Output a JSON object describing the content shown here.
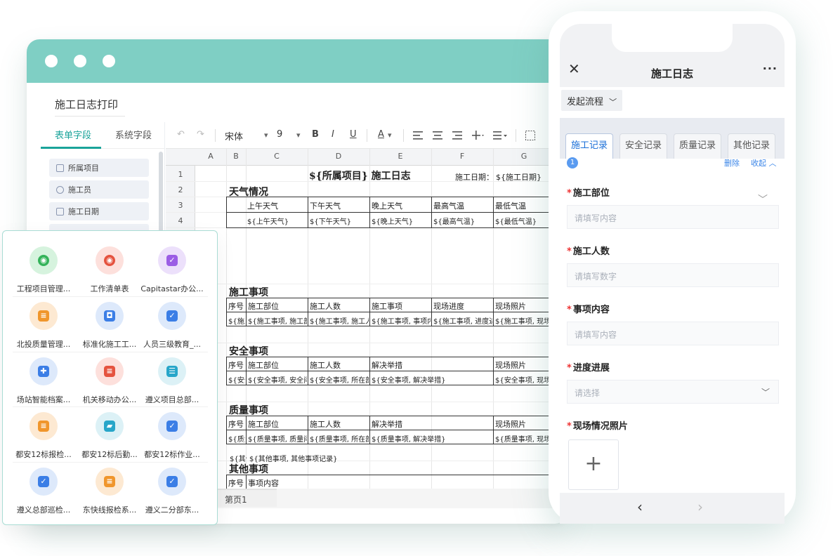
{
  "desktop": {
    "doc_title": "施工日志打印",
    "side_tabs": [
      "表单字段",
      "系统字段"
    ],
    "fields": [
      "所属项目",
      "施工员",
      "施工日期"
    ],
    "toolbar": {
      "undo": "↶",
      "redo": "↷",
      "font": "宋体",
      "font_caret": "▾",
      "size": "9",
      "size_caret": "▾",
      "bold": "B",
      "italic": "I",
      "underline": "U",
      "font_color": "A",
      "color_caret": "▾"
    },
    "columns": [
      "A",
      "B",
      "C",
      "D",
      "E",
      "F",
      "G"
    ],
    "rows": [
      "1",
      "2",
      "3",
      "4"
    ],
    "sheet_tab": "第页1"
  },
  "sheet": {
    "title": "${所属项目} 施工日志",
    "date_label": "施工日期：",
    "date_value": "${施工日期}",
    "weather": {
      "heading": "天气情况",
      "headers": [
        "上午天气",
        "下午天气",
        "晚上天气",
        "最高气温",
        "最低气温"
      ],
      "values": [
        "${上午天气}",
        "${下午天气}",
        "${晚上天气}",
        "${最高气温}",
        "${最低气温}"
      ]
    },
    "construction": {
      "heading": "施工事项",
      "headers": [
        "序号",
        "施工部位",
        "施工人数",
        "施工事项",
        "现场进度",
        "现场照片"
      ],
      "values": [
        "${施工事项",
        "${施工事项, 施工部位}",
        "${施工事项, 施工人数}",
        "${施工事项, 事项内容}",
        "${施工事项, 进度进展}",
        "${施工事项, 现场情况照片}"
      ]
    },
    "safety": {
      "heading": "安全事项",
      "headers": [
        "序号",
        "施工部位",
        "施工人数",
        "解决举措",
        "现场照片"
      ],
      "values": [
        "${安全",
        "${安全事项, 安全问题点}",
        "${安全事项, 所在部位}",
        "${安全事项, 解决举措}",
        "${安全事项, 现场照片}"
      ]
    },
    "quality": {
      "heading": "质量事项",
      "headers": [
        "序号",
        "施工部位",
        "施工人数",
        "解决举措",
        "现场照片"
      ],
      "values": [
        "${质量",
        "${质量事项, 质量问题点}",
        "${质量事项, 所在部位}",
        "${质量事项, 解决举措}",
        "${质量事项, 现场照片}"
      ]
    },
    "other": {
      "heading": "其他事项",
      "headers": [
        "序号",
        "事项内容"
      ],
      "values": [
        "${其他事项",
        "${其他事项, 其他事项记录}"
      ]
    }
  },
  "apps": [
    {
      "label": "工程项目管理...",
      "color": "#d6f3de",
      "glyph_color": "#34b35a",
      "icon": "globe-icon"
    },
    {
      "label": "工作清单表",
      "color": "#fde0dc",
      "glyph_color": "#e5533f",
      "icon": "globe-icon"
    },
    {
      "label": "Capitastar办公...",
      "color": "#ece0fb",
      "glyph_color": "#9b5de5",
      "icon": "shield-check-icon"
    },
    {
      "label": "北投质量管理...",
      "color": "#fde9d2",
      "glyph_color": "#f0962c",
      "icon": "document-icon"
    },
    {
      "label": "标准化施工工...",
      "color": "#dde9fb",
      "glyph_color": "#3b7ee6",
      "icon": "robot-icon"
    },
    {
      "label": "人员三级教育_...",
      "color": "#dde9fb",
      "glyph_color": "#3b7ee6",
      "icon": "shield-check-icon"
    },
    {
      "label": "场站智能档案...",
      "color": "#dde9fb",
      "glyph_color": "#3b7ee6",
      "icon": "puzzle-icon"
    },
    {
      "label": "机关移动办公...",
      "color": "#fde0dc",
      "glyph_color": "#e5533f",
      "icon": "document-icon"
    },
    {
      "label": "遵义项目总部...",
      "color": "#dcf1f6",
      "glyph_color": "#27a6c9",
      "icon": "database-icon"
    },
    {
      "label": "都安12标报检...",
      "color": "#fde9d2",
      "glyph_color": "#f0962c",
      "icon": "document-icon"
    },
    {
      "label": "都安12标后勤...",
      "color": "#dcf1f6",
      "glyph_color": "#27a6c9",
      "icon": "folder-user-icon"
    },
    {
      "label": "都安12标作业...",
      "color": "#dde9fb",
      "glyph_color": "#3b7ee6",
      "icon": "shield-check-icon"
    },
    {
      "label": "遵义总部巡检...",
      "color": "#dde9fb",
      "glyph_color": "#3b7ee6",
      "icon": "shield-check-icon"
    },
    {
      "label": "东快线报检系...",
      "color": "#fde9d2",
      "glyph_color": "#f0962c",
      "icon": "document-icon"
    },
    {
      "label": "遵义二分部东...",
      "color": "#dde9fb",
      "glyph_color": "#3b7ee6",
      "icon": "shield-check-icon"
    }
  ],
  "phone": {
    "close": "✕",
    "title": "施工日志",
    "more": "···",
    "flow_button": "发起流程",
    "flow_caret": "﹀",
    "tabs": [
      "施工记录",
      "安全记录",
      "质量记录",
      "其他记录"
    ],
    "badge": "1",
    "delete": "删除",
    "fold": "收起 ︿",
    "fold_chevron": "﹀",
    "required_mark": "*",
    "fields": [
      {
        "label": "施工部位",
        "placeholder": "请填写内容"
      },
      {
        "label": "施工人数",
        "placeholder": "请填写数字"
      },
      {
        "label": "事项内容",
        "placeholder": "请填写内容"
      },
      {
        "label": "进度进展",
        "placeholder": "请选择"
      },
      {
        "label": "现场情况照片"
      }
    ],
    "select_caret": "﹀",
    "upload": "+",
    "prev": "‹",
    "next": "›"
  },
  "colors": {
    "teal": "#7fcfc4",
    "accent": "#1aa39a",
    "blue": "#1a6fd8"
  }
}
